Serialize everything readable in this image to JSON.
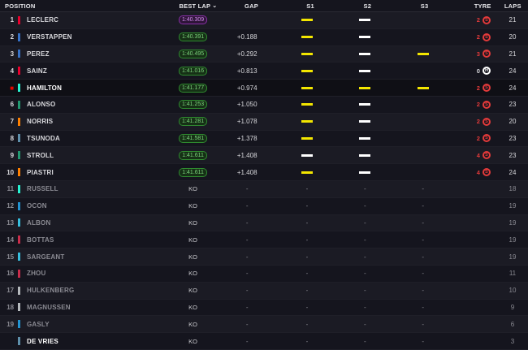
{
  "header": {
    "position": "POSITION",
    "best_lap": "BEST LAP",
    "gap": "GAP",
    "s1": "S1",
    "s2": "S2",
    "s3": "S3",
    "tyre": "TYRE",
    "laps": "LAPS"
  },
  "colors": {
    "purple": "#c05be0",
    "green": "#3ab93a",
    "yellow": "#f3e600",
    "white": "#ffffff",
    "soft": "#e33a3a",
    "medium": "#f3e600",
    "hard": "#ffffff"
  },
  "rows": [
    {
      "pos": "1",
      "name": "LECLERC",
      "team": "#e8002d",
      "best": "1:40.309",
      "best_style": "purple",
      "gap": "",
      "s1": "yellow",
      "s2": "white",
      "s3": "",
      "tyre_laps": "2",
      "tyre": "S",
      "tyre_color": "soft",
      "laps": "21"
    },
    {
      "pos": "2",
      "name": "VERSTAPPEN",
      "team": "#3671c6",
      "best": "1:40.391",
      "best_style": "green",
      "gap": "+0.188",
      "s1": "yellow",
      "s2": "white",
      "s3": "",
      "tyre_laps": "2",
      "tyre": "S",
      "tyre_color": "soft",
      "laps": "20"
    },
    {
      "pos": "3",
      "name": "PEREZ",
      "team": "#3671c6",
      "best": "1:40.495",
      "best_style": "green",
      "gap": "+0.292",
      "s1": "yellow",
      "s2": "white",
      "s3": "yellow",
      "tyre_laps": "3",
      "tyre": "S",
      "tyre_color": "soft",
      "laps": "21"
    },
    {
      "pos": "4",
      "name": "SAINZ",
      "team": "#e8002d",
      "best": "1:41.016",
      "best_style": "green",
      "gap": "+0.813",
      "s1": "yellow",
      "s2": "white",
      "s3": "",
      "tyre_laps": "0",
      "tyre": "H",
      "tyre_color": "hard",
      "laps": "24"
    },
    {
      "pos": "■",
      "name": "HAMILTON",
      "team": "#27f4d2",
      "best": "1:41.177",
      "best_style": "green",
      "gap": "+0.974",
      "s1": "yellow",
      "s2": "yellow",
      "s3": "yellow",
      "tyre_laps": "2",
      "tyre": "S",
      "tyre_color": "soft",
      "laps": "24",
      "highlight": true
    },
    {
      "pos": "6",
      "name": "ALONSO",
      "team": "#229971",
      "best": "1:41.253",
      "best_style": "green",
      "gap": "+1.050",
      "s1": "yellow",
      "s2": "white",
      "s3": "",
      "tyre_laps": "2",
      "tyre": "S",
      "tyre_color": "soft",
      "laps": "23"
    },
    {
      "pos": "7",
      "name": "NORRIS",
      "team": "#ff8000",
      "best": "1:41.281",
      "best_style": "green",
      "gap": "+1.078",
      "s1": "yellow",
      "s2": "white",
      "s3": "",
      "tyre_laps": "2",
      "tyre": "S",
      "tyre_color": "soft",
      "laps": "20"
    },
    {
      "pos": "8",
      "name": "TSUNODA",
      "team": "#5e8faa",
      "best": "1:41.581",
      "best_style": "green",
      "gap": "+1.378",
      "s1": "yellow",
      "s2": "white",
      "s3": "",
      "tyre_laps": "2",
      "tyre": "S",
      "tyre_color": "soft",
      "laps": "23"
    },
    {
      "pos": "9",
      "name": "STROLL",
      "team": "#229971",
      "best": "1:41.611",
      "best_style": "green",
      "gap": "+1.408",
      "s1": "white",
      "s2": "white",
      "s3": "",
      "tyre_laps": "4",
      "tyre": "S",
      "tyre_color": "soft",
      "laps": "23"
    },
    {
      "pos": "10",
      "name": "PIASTRI",
      "team": "#ff8000",
      "best": "1:41.611",
      "best_style": "green",
      "gap": "+1.408",
      "s1": "yellow",
      "s2": "white",
      "s3": "",
      "tyre_laps": "4",
      "tyre": "S",
      "tyre_color": "soft",
      "laps": "24"
    },
    {
      "pos": "11",
      "name": "RUSSELL",
      "team": "#27f4d2",
      "best": "KO",
      "best_style": "ko",
      "gap": "-",
      "s1": "-",
      "s2": "-",
      "s3": "-",
      "laps": "18",
      "out": true
    },
    {
      "pos": "12",
      "name": "OCON",
      "team": "#2293d1",
      "best": "KO",
      "best_style": "ko",
      "gap": "-",
      "s1": "-",
      "s2": "-",
      "s3": "-",
      "laps": "19",
      "out": true
    },
    {
      "pos": "13",
      "name": "ALBON",
      "team": "#37bedd",
      "best": "KO",
      "best_style": "ko",
      "gap": "-",
      "s1": "-",
      "s2": "-",
      "s3": "-",
      "laps": "19",
      "out": true
    },
    {
      "pos": "14",
      "name": "BOTTAS",
      "team": "#c92d4b",
      "best": "KO",
      "best_style": "ko",
      "gap": "-",
      "s1": "-",
      "s2": "-",
      "s3": "-",
      "laps": "19",
      "out": true
    },
    {
      "pos": "15",
      "name": "SARGEANT",
      "team": "#37bedd",
      "best": "KO",
      "best_style": "ko",
      "gap": "-",
      "s1": "-",
      "s2": "-",
      "s3": "-",
      "laps": "19",
      "out": true
    },
    {
      "pos": "16",
      "name": "ZHOU",
      "team": "#c92d4b",
      "best": "KO",
      "best_style": "ko",
      "gap": "-",
      "s1": "-",
      "s2": "-",
      "s3": "-",
      "laps": "11",
      "out": true
    },
    {
      "pos": "17",
      "name": "HULKENBERG",
      "team": "#b6babd",
      "best": "KO",
      "best_style": "ko",
      "gap": "-",
      "s1": "-",
      "s2": "-",
      "s3": "-",
      "laps": "10",
      "out": true
    },
    {
      "pos": "18",
      "name": "MAGNUSSEN",
      "team": "#b6babd",
      "best": "KO",
      "best_style": "ko",
      "gap": "-",
      "s1": "-",
      "s2": "-",
      "s3": "-",
      "laps": "9",
      "out": true
    },
    {
      "pos": "19",
      "name": "GASLY",
      "team": "#2293d1",
      "best": "KO",
      "best_style": "ko",
      "gap": "-",
      "s1": "-",
      "s2": "-",
      "s3": "-",
      "laps": "6",
      "out": true
    },
    {
      "pos": "",
      "name": "DE VRIES",
      "team": "#5e8faa",
      "best": "KO",
      "best_style": "ko",
      "gap": "-",
      "s1": "-",
      "s2": "-",
      "s3": "-",
      "laps": "3",
      "out": true,
      "selected": true
    }
  ]
}
